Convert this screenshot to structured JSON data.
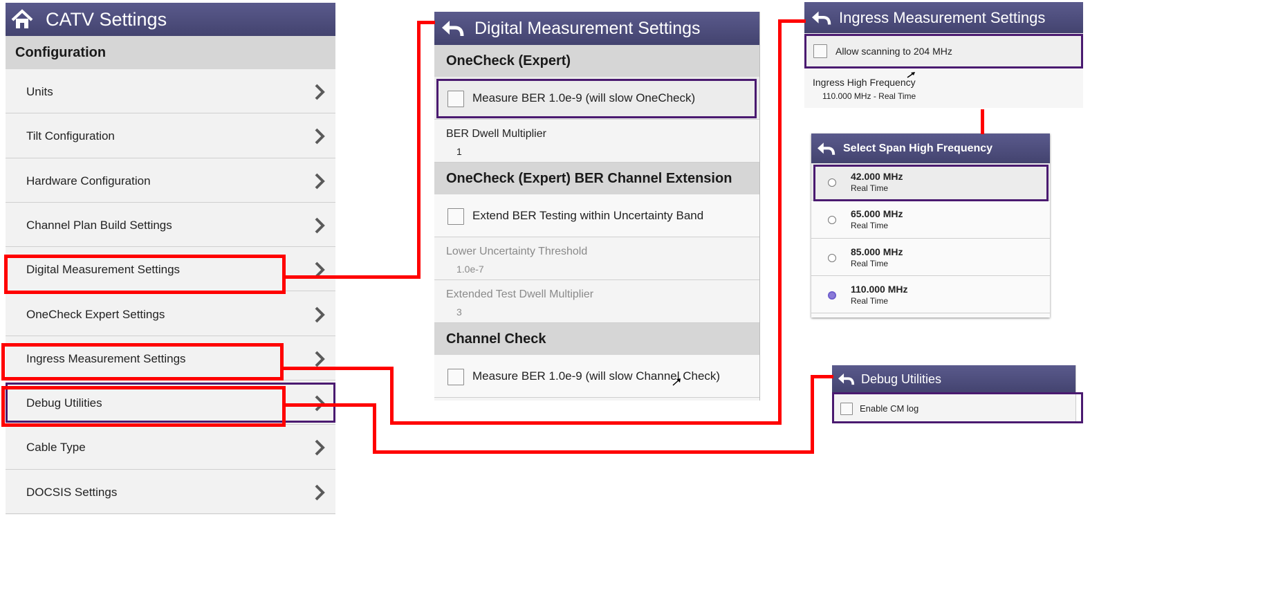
{
  "catv": {
    "title": "CATV Settings",
    "section": "Configuration",
    "items": [
      {
        "label": "Units"
      },
      {
        "label": "Tilt Configuration"
      },
      {
        "label": "Hardware Configuration"
      },
      {
        "label": "Channel Plan Build Settings"
      },
      {
        "label": "Digital Measurement Settings"
      },
      {
        "label": "OneCheck Expert Settings"
      },
      {
        "label": "Ingress Measurement Settings"
      },
      {
        "label": "Debug Utilities"
      },
      {
        "label": "Cable Type"
      },
      {
        "label": "DOCSIS Settings"
      }
    ]
  },
  "digital": {
    "title": "Digital Measurement Settings",
    "sections": [
      "OneCheck (Expert)",
      "OneCheck (Expert) BER Channel Extension",
      "Channel Check"
    ],
    "measure_ber_label": "Measure BER 1.0e-9 (will slow OneCheck)",
    "ber_dwell_label": "BER Dwell Multiplier",
    "ber_dwell_value": "1",
    "extend_ber_label": "Extend BER Testing within Uncertainty Band",
    "lower_threshold_label": "Lower Uncertainty Threshold",
    "lower_threshold_value": "1.0e-7",
    "ext_dwell_label": "Extended Test Dwell Multiplier",
    "ext_dwell_value": "3",
    "measure_ber_cc_label": "Measure BER 1.0e-9 (will slow Channel Check)"
  },
  "ingress": {
    "title": "Ingress Measurement Settings",
    "allow_label": "Allow scanning to 204 MHz",
    "high_freq_label": "Ingress High Frequency",
    "high_freq_value": "110.000 MHz - Real Time"
  },
  "span": {
    "title": "Select Span High Frequency",
    "options": [
      {
        "freq": "42.000 MHz",
        "mode": "Real Time"
      },
      {
        "freq": "65.000 MHz",
        "mode": "Real Time"
      },
      {
        "freq": "85.000 MHz",
        "mode": "Real Time"
      },
      {
        "freq": "110.000 MHz",
        "mode": "Real Time"
      }
    ],
    "selected_index": 3
  },
  "debug": {
    "title": "Debug Utilities",
    "cm_log_label": "Enable CM log"
  },
  "colors": {
    "header": "#4d4d7d",
    "highlight_red": "#ff0000",
    "highlight_purple": "#4a1a70",
    "section_gray": "#d6d6d6",
    "panel_bg": "#f2f2f2"
  },
  "icons": [
    "home-icon",
    "back-arrow-icon",
    "chevron-right-icon",
    "checkbox-icon",
    "radio-icon"
  ]
}
